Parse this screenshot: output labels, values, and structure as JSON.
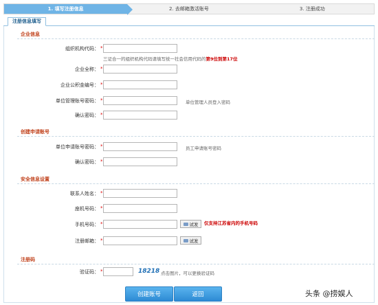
{
  "steps": [
    "1. 填写注册信息",
    "2. 去邮箱激活账号",
    "3. 注册成功"
  ],
  "tab": "注册信息填写",
  "sections": {
    "company": "企业信息",
    "account": "创建申请账号",
    "security": "安全信息设置",
    "register": "注册码"
  },
  "fields": {
    "org_code": "组织机构代码：",
    "org_code_hint": "三证合一的组织机构代码请填写统一社会信用代码的",
    "org_code_hint_red": "第9位到第17位",
    "company_name": "企业全称：",
    "fund_no": "企业公积金编号：",
    "admin_pwd": "单位管理账号密码：",
    "admin_pwd_hint": "单位管理人员登入密码",
    "confirm_pwd": "确认密码：",
    "apply_pwd": "单位申请账号密码：",
    "apply_pwd_hint": "员工申请账号密码",
    "confirm_pwd2": "确认密码：",
    "contact_name": "联系人姓名：",
    "landline": "座机号码：",
    "mobile": "手机号码：",
    "mobile_hint_red": "仅支持江苏省内的手机号码",
    "email": "注册邮箱：",
    "captcha_label": "验证码：",
    "captcha_value": "18218",
    "captcha_hint": "点击图片，可以更换验证码",
    "required": "*",
    "try_label": "试发"
  },
  "buttons": {
    "create": "创建账号",
    "back": "返回"
  },
  "watermark": "头条 @捞娱人"
}
